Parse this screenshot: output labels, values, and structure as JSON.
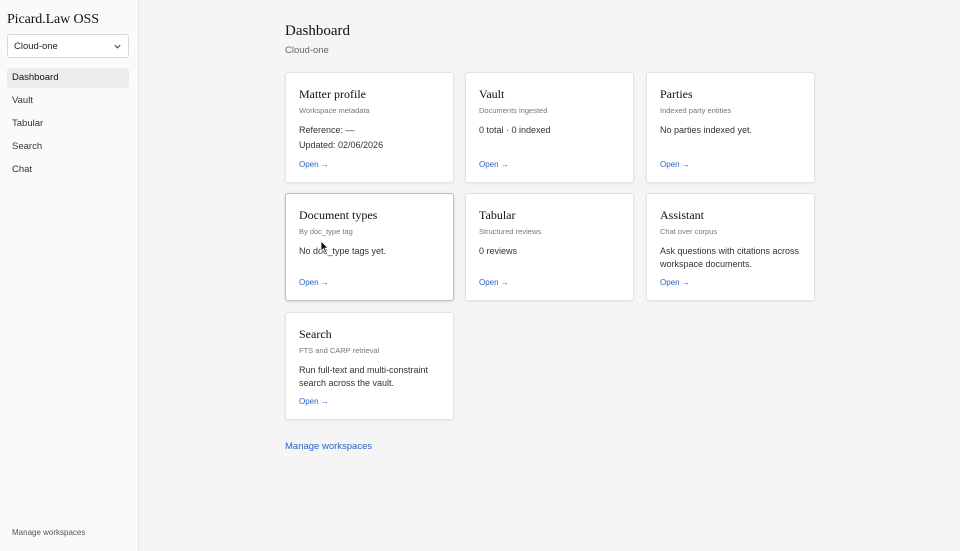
{
  "sidebar": {
    "brand": "Picard.Law OSS",
    "workspace_selected": "Cloud-one",
    "items": [
      {
        "label": "Dashboard",
        "active": true
      },
      {
        "label": "Vault"
      },
      {
        "label": "Tabular"
      },
      {
        "label": "Search"
      },
      {
        "label": "Chat"
      }
    ],
    "footer": "Manage workspaces"
  },
  "main": {
    "title": "Dashboard",
    "subtitle": "Cloud-one",
    "cards": [
      {
        "title": "Matter profile",
        "subtitle": "Workspace metadata",
        "body": [
          "Reference: —",
          "Updated: 02/06/2026"
        ],
        "link": "Open →"
      },
      {
        "title": "Vault",
        "subtitle": "Documents ingested",
        "body": [
          "0 total · 0 indexed"
        ],
        "link": "Open →"
      },
      {
        "title": "Parties",
        "subtitle": "Indexed party entities",
        "body": [
          "No parties indexed yet."
        ],
        "link": "Open →"
      },
      {
        "title": "Document types",
        "subtitle": "By doc_type tag",
        "body": [
          "No doc_type tags yet."
        ],
        "link": "Open →"
      },
      {
        "title": "Tabular",
        "subtitle": "Structured reviews",
        "body": [
          "0 reviews"
        ],
        "link": "Open →"
      },
      {
        "title": "Assistant",
        "subtitle": "Chat over corpus",
        "body": [
          "Ask questions with citations across workspace documents."
        ],
        "link": "Open →"
      },
      {
        "title": "Search",
        "subtitle": "FTS and CARP retrieval",
        "body": [
          "Run full-text and multi-constraint search across the vault."
        ],
        "link": "Open →"
      }
    ],
    "manage_link": "Manage workspaces"
  },
  "colors": {
    "link": "#2a63c7",
    "background": "#f5f5f5",
    "sidebar": "#fafafa"
  }
}
